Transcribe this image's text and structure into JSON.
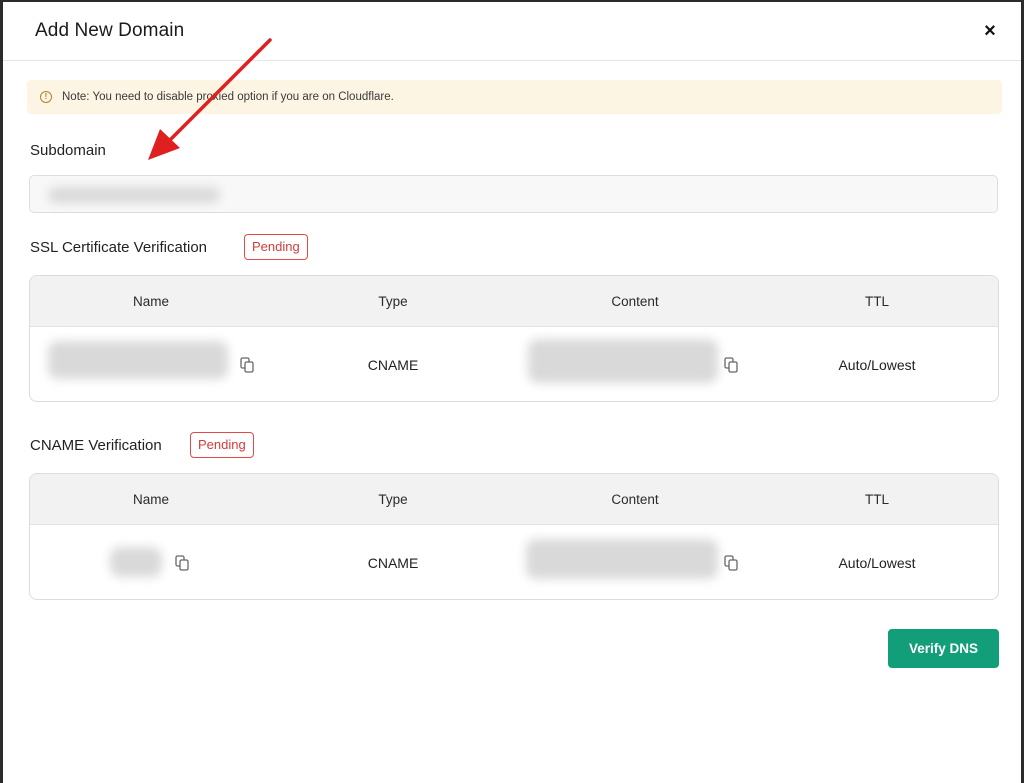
{
  "modal": {
    "title": "Add New Domain",
    "close_label": "×"
  },
  "note": {
    "icon": "info-icon",
    "text": "Note: You need to disable proxied option if you are on Cloudflare."
  },
  "subdomain": {
    "label": "Subdomain",
    "value": ""
  },
  "ssl": {
    "title": "SSL Certificate Verification",
    "status": "Pending",
    "columns": [
      "Name",
      "Type",
      "Content",
      "TTL"
    ],
    "row": {
      "name": "",
      "type": "CNAME",
      "content": "",
      "ttl": "Auto/Lowest"
    }
  },
  "cname": {
    "title": "CNAME Verification",
    "status": "Pending",
    "columns": [
      "Name",
      "Type",
      "Content",
      "TTL"
    ],
    "row": {
      "name": "",
      "type": "CNAME",
      "content": "",
      "ttl": "Auto/Lowest"
    }
  },
  "actions": {
    "verify_label": "Verify DNS"
  },
  "colors": {
    "accent": "#139e7a",
    "pending": "#d63b3b",
    "note_bg": "#fdf5e3",
    "annotation_arrow": "#e02020"
  }
}
